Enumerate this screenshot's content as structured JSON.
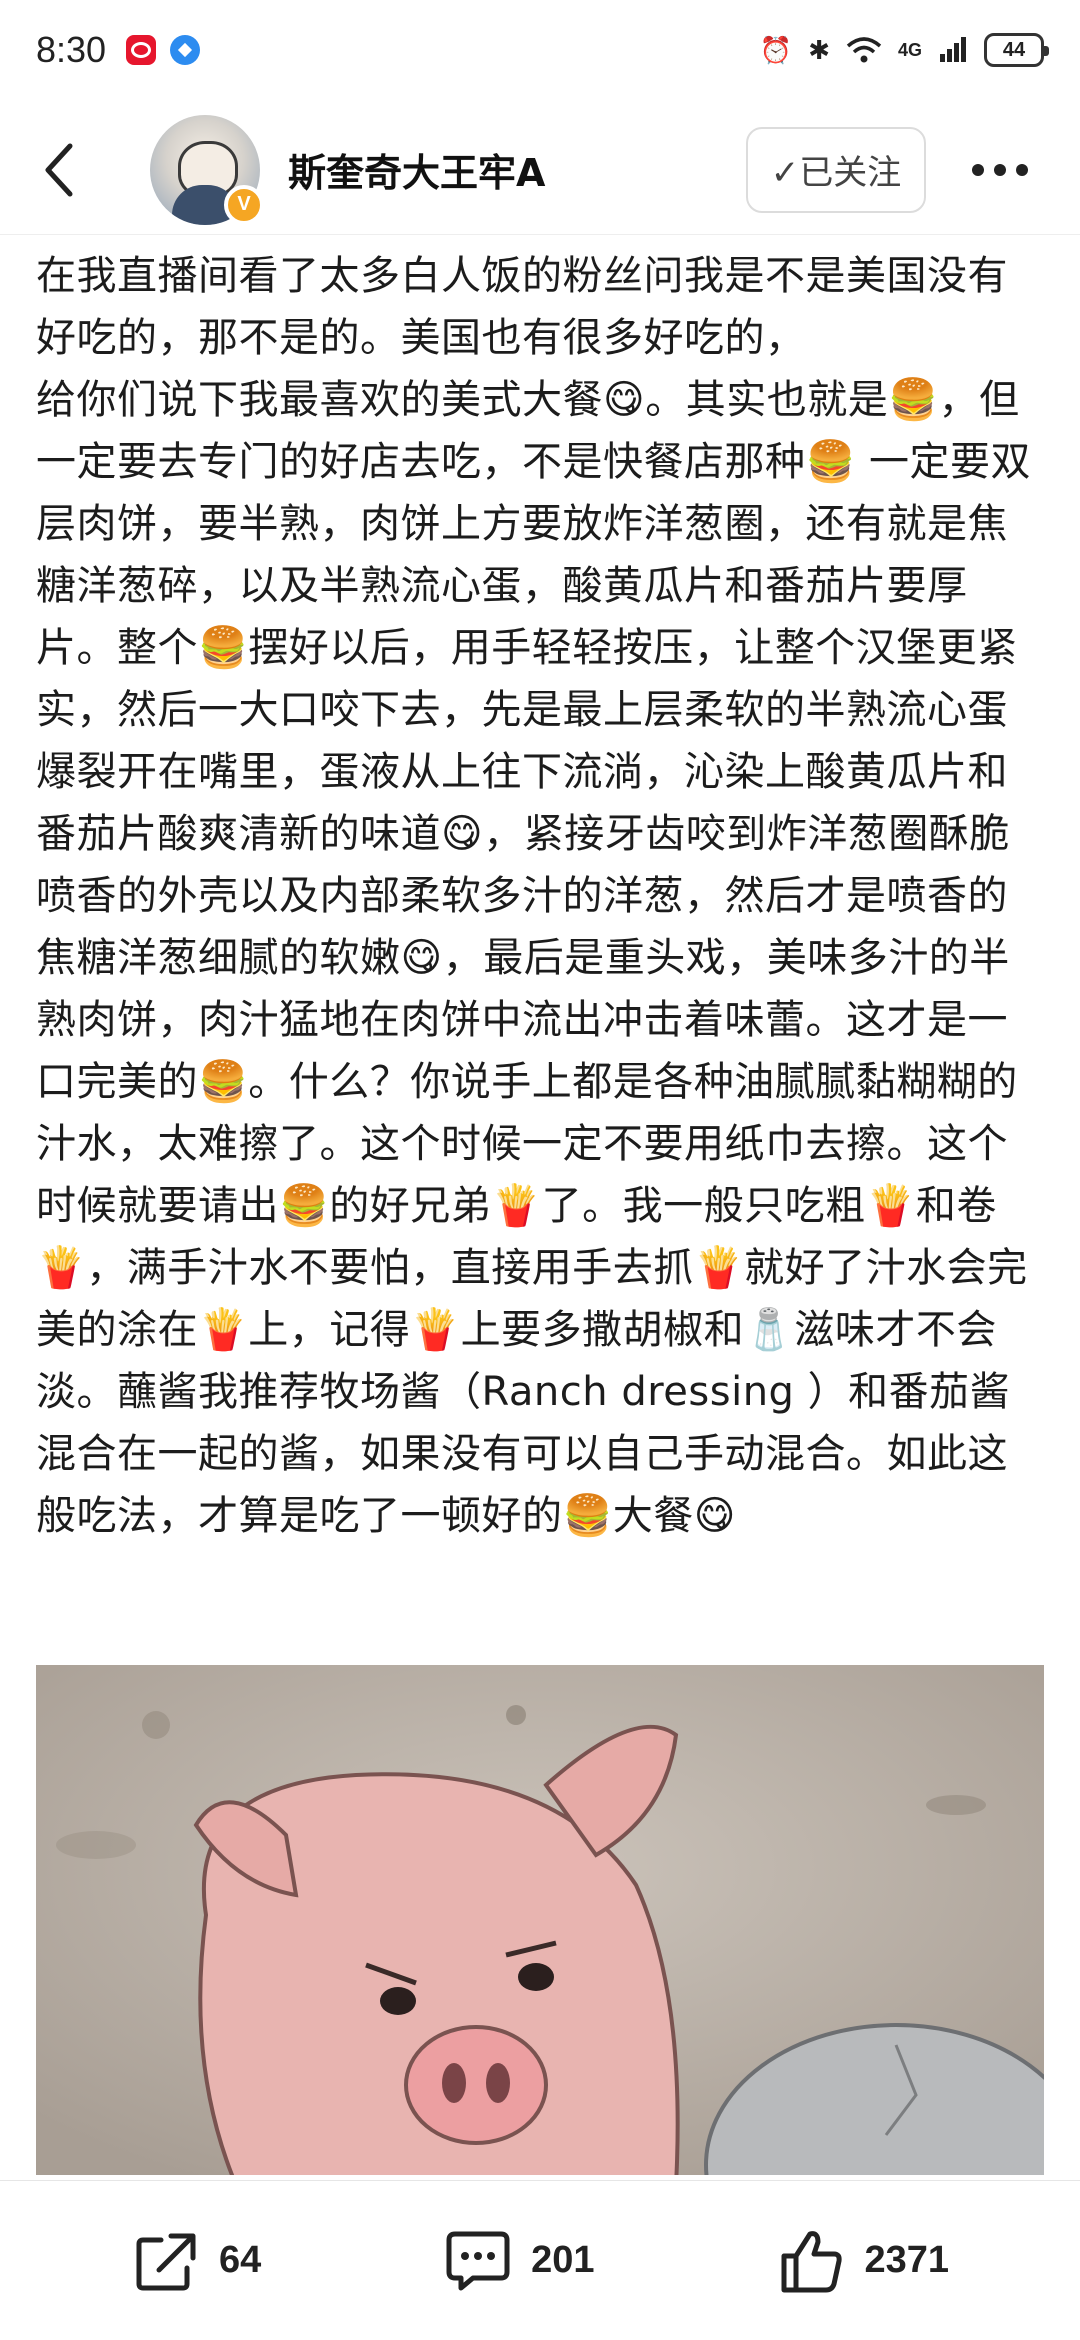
{
  "status_bar": {
    "time": "8:30",
    "network": "4G",
    "battery": "44"
  },
  "header": {
    "username": "斯奎奇大王牢A",
    "follow_label": "✓已关注",
    "verified_label": "V"
  },
  "post": {
    "text": "在我直播间看了太多白人饭的粉丝问我是不是美国没有好吃的，那不是的。美国也有很多好吃的，\n给你们说下我最喜欢的美式大餐😋。其实也就是🍔，但一定要去专门的好店去吃，不是快餐店那种🍔 一定要双层肉饼，要半熟，肉饼上方要放炸洋葱圈，还有就是焦糖洋葱碎，以及半熟流心蛋，酸黄瓜片和番茄片要厚片。整个🍔摆好以后，用手轻轻按压，让整个汉堡更紧实，然后一大口咬下去，先是最上层柔软的半熟流心蛋爆裂开在嘴里，蛋液从上往下流淌，沁染上酸黄瓜片和番茄片酸爽清新的味道😋，紧接牙齿咬到炸洋葱圈酥脆喷香的外壳以及内部柔软多汁的洋葱，然后才是喷香的焦糖洋葱细腻的软嫩😋，最后是重头戏，美味多汁的半熟肉饼，肉汁猛地在肉饼中流出冲击着味蕾。这才是一口完美的🍔。什么？你说手上都是各种油腻腻黏糊糊的汁水，太难擦了。这个时候一定不要用纸巾去擦。这个时候就要请出🍔的好兄弟🍟了。我一般只吃粗🍟和卷🍟，满手汁水不要怕，直接用手去抓🍟就好了汁水会完美的涂在🍟上，记得🍟上要多撒胡椒和🧂滋味才不会淡。蘸酱我推荐牧场酱（Ranch dressing ）和番茄酱混合在一起的酱，如果没有可以自己手动混合。如此这般吃法，才算是吃了一顿好的🍔大餐😋"
  },
  "actions": {
    "share_count": "64",
    "comment_count": "201",
    "like_count": "2371"
  },
  "icons": {
    "back": "back-arrow-icon",
    "more": "more-dots-icon",
    "share": "share-icon",
    "comment": "comment-icon",
    "like": "thumbs-up-icon"
  }
}
